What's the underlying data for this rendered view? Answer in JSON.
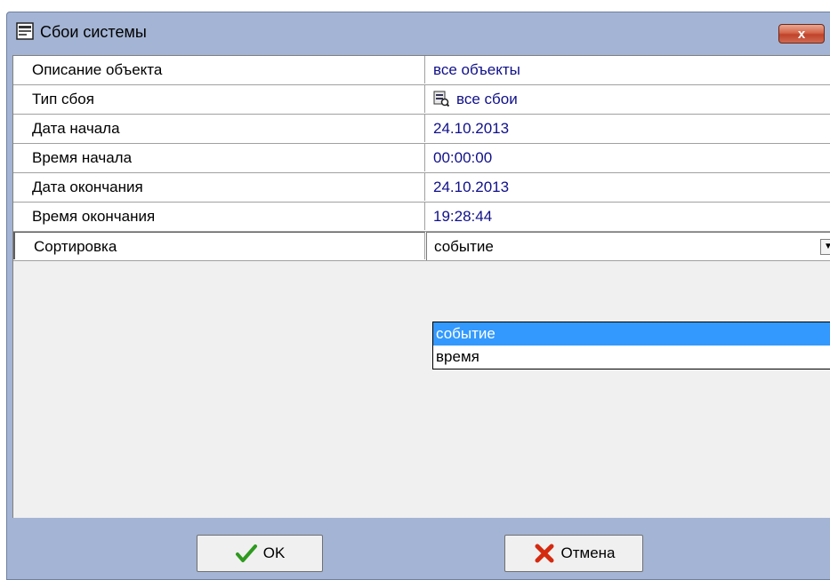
{
  "window": {
    "title": "Сбои системы",
    "close_label": "x"
  },
  "rows": [
    {
      "label": "Описание объекта",
      "value": "все объекты"
    },
    {
      "label": "Тип сбоя",
      "value": "все сбои"
    },
    {
      "label": "Дата начала",
      "value": "24.10.2013"
    },
    {
      "label": "Время начала",
      "value": "00:00:00"
    },
    {
      "label": "Дата окончания",
      "value": "24.10.2013"
    },
    {
      "label": "Время окончания",
      "value": "19:28:44"
    },
    {
      "label": "Сортировка",
      "value": "событие"
    }
  ],
  "dropdown": {
    "options": [
      "событие",
      "время"
    ],
    "selected_index": 0
  },
  "buttons": {
    "ok_label": "OK",
    "cancel_label": "Отмена"
  },
  "colors": {
    "accent": "#3399ff",
    "value_text": "#10108a",
    "frame": "#a4b4d4"
  }
}
